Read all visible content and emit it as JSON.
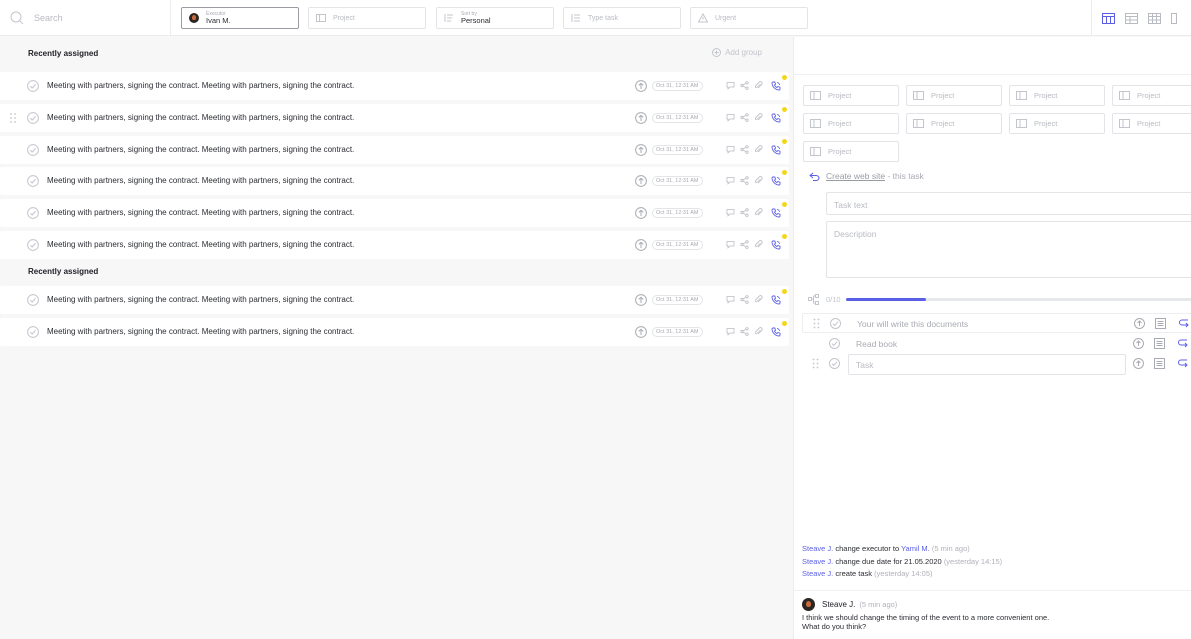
{
  "topbar": {
    "search_placeholder": "Search",
    "filters": {
      "executor": {
        "label": "Executor",
        "value": "Ivan M."
      },
      "project": {
        "placeholder": "Project"
      },
      "sort": {
        "label": "Sort by",
        "value": "Personal"
      },
      "type": {
        "placeholder": "Type task"
      },
      "urgent": {
        "placeholder": "Urgent"
      }
    },
    "views": [
      "board-view-icon",
      "list-view-icon",
      "table-view-icon"
    ]
  },
  "task_list": {
    "add_group_label": "Add group",
    "groups": [
      {
        "title": "Recently assigned",
        "tasks": [
          {
            "text": "Meeting with partners, signing the contract. Meeting with  partners, signing the contract.",
            "date": "Oct 31, 12:31 AM"
          },
          {
            "text": "Meeting with partners, signing the contract. Meeting with  partners, signing the contract.",
            "date": "Oct 31, 12:31 AM"
          },
          {
            "text": "Meeting with partners, signing the contract. Meeting with  partners, signing the contract.",
            "date": "Oct 31, 12:31 AM"
          },
          {
            "text": "Meeting with partners, signing the contract. Meeting with  partners, signing the contract.",
            "date": "Oct 31, 12:31 AM"
          },
          {
            "text": "Meeting with partners, signing the contract. Meeting with  partners, signing the contract.",
            "date": "Oct 31, 12:31 AM"
          },
          {
            "text": "Meeting with partners, signing the contract. Meeting with  partners, signing the contract.",
            "date": "Oct 31, 12:31 AM"
          }
        ]
      },
      {
        "title": "Recently assigned",
        "tasks": [
          {
            "text": "Meeting with partners, signing the contract. Meeting with  partners, signing the contract.",
            "date": "Oct 31, 12:31 AM"
          },
          {
            "text": "Meeting with partners, signing the contract. Meeting with  partners, signing the contract.",
            "date": "Oct 31, 12:31 AM"
          }
        ]
      }
    ]
  },
  "detail": {
    "projects": [
      "Project",
      "Project",
      "Project",
      "Project",
      "Project",
      "Project",
      "Project",
      "Project",
      "Project"
    ],
    "parent": {
      "link": "Create web site",
      "suffix": " - this task"
    },
    "task_text_placeholder": "Task text",
    "description_placeholder": "Description",
    "subtasks": {
      "count": "0/10",
      "progress": 0.23,
      "items": [
        {
          "text": "Your will write this documents"
        },
        {
          "text": "Read book"
        }
      ],
      "new_placeholder": "Task"
    },
    "history": [
      {
        "who": "Steave J.",
        "action": " change executor to ",
        "target": "Yamil M.",
        "rest": "",
        "when": "(5 min ago)"
      },
      {
        "who": "Steave J.",
        "action": " change due date for 21.05.2020",
        "target": "",
        "rest": "",
        "when": "(yesterday 14:15)"
      },
      {
        "who": "Steave J.",
        "action": " create task",
        "target": "",
        "rest": "",
        "when": "(yesterday 14:05)"
      }
    ],
    "comment": {
      "author": "Steave J.",
      "time": "(5 min ago)",
      "line1": "I think we should change the timing of the event to a more convenient one.",
      "line2": "What do you think?"
    }
  },
  "colors": {
    "accent": "#5b5fe6",
    "dot": "#f5d41f",
    "background": "#f7f7f8"
  }
}
